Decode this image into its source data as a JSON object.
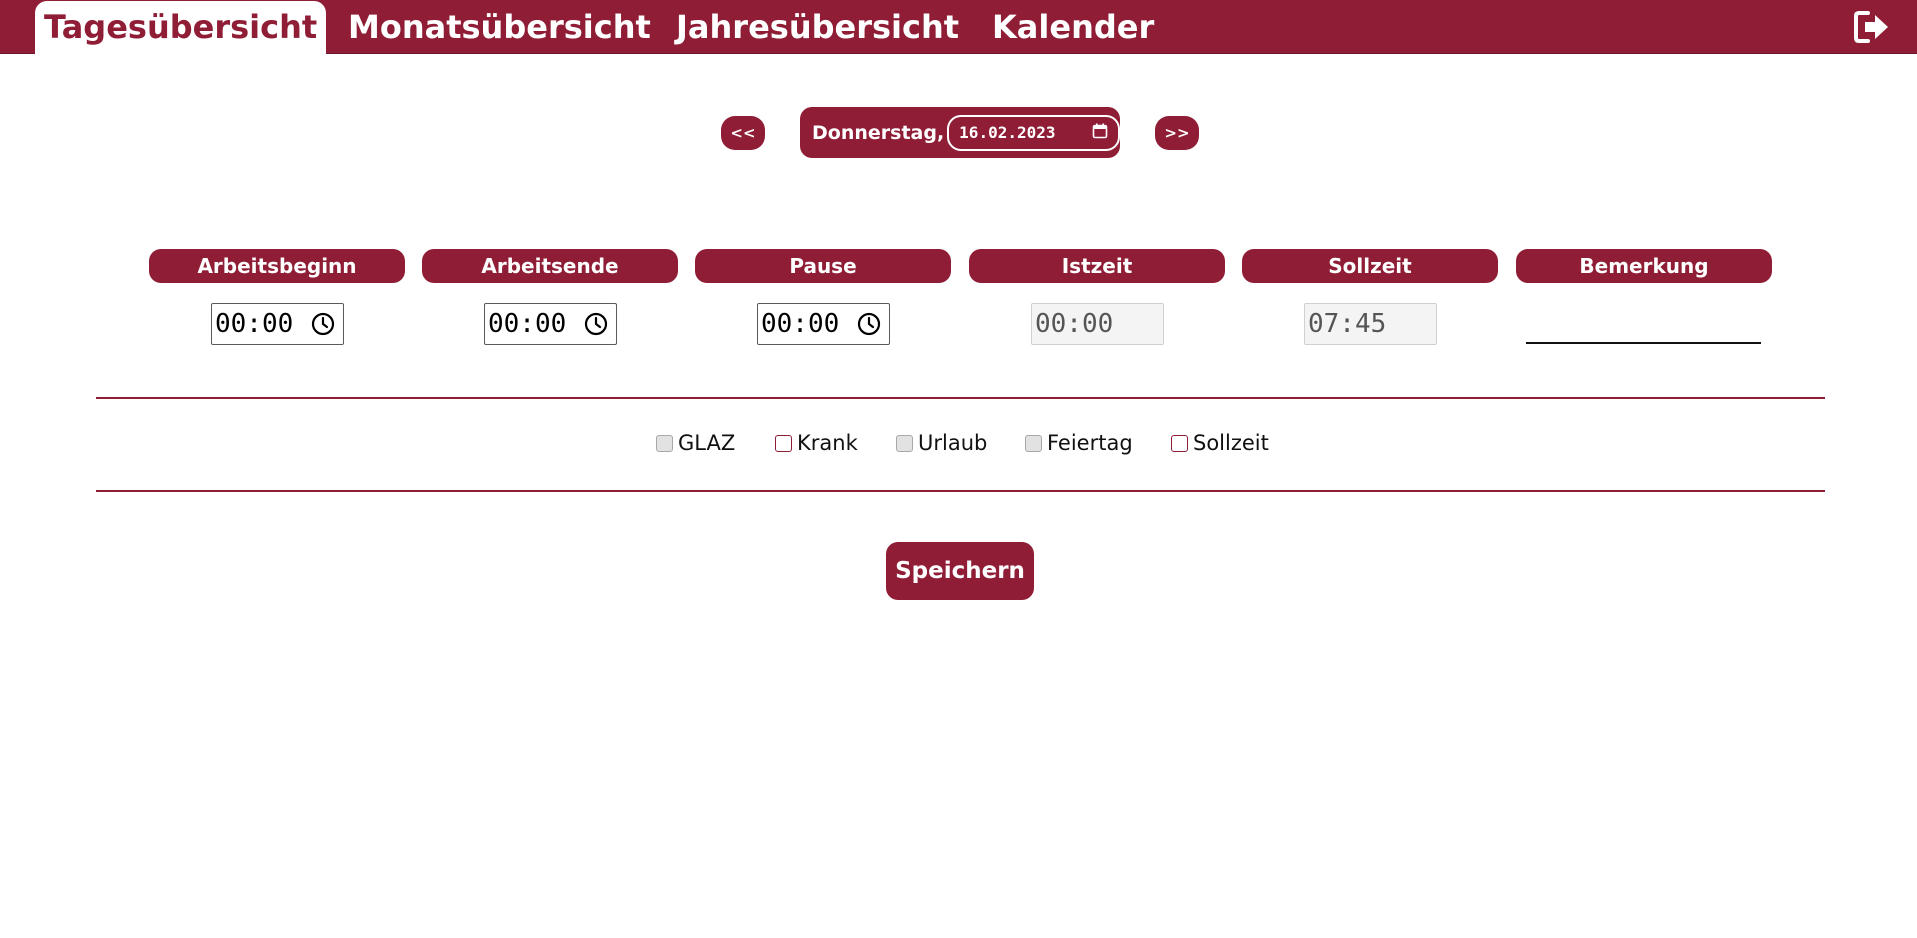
{
  "nav": {
    "tabs": [
      {
        "label": "Tagesübersicht",
        "active": true
      },
      {
        "label": "Monatsübersicht",
        "active": false
      },
      {
        "label": "Jahresübersicht",
        "active": false
      },
      {
        "label": "Kalender",
        "active": false
      }
    ],
    "logout_icon": "logout-icon"
  },
  "date_nav": {
    "prev_label": "<<",
    "next_label": ">>",
    "weekday": "Donnerstag,",
    "date_value": "16.02.2023",
    "calendar_icon": "calendar-icon"
  },
  "columns": {
    "headers": [
      "Arbeitsbeginn",
      "Arbeitsende",
      "Pause",
      "Istzeit",
      "Sollzeit",
      "Bemerkung"
    ]
  },
  "values": {
    "arbeitsbeginn": "00:00",
    "arbeitsende": "00:00",
    "pause": "00:00",
    "istzeit": "00:00",
    "sollzeit": "07:45",
    "bemerkung": ""
  },
  "checkboxes": [
    {
      "label": "GLAZ",
      "enabled": false,
      "checked": false
    },
    {
      "label": "Krank",
      "enabled": true,
      "checked": false
    },
    {
      "label": "Urlaub",
      "enabled": false,
      "checked": false
    },
    {
      "label": "Feiertag",
      "enabled": false,
      "checked": false
    },
    {
      "label": "Sollzeit",
      "enabled": true,
      "checked": false
    }
  ],
  "save_label": "Speichern",
  "colors": {
    "accent": "#8f1d36",
    "background": "#ffffff"
  }
}
